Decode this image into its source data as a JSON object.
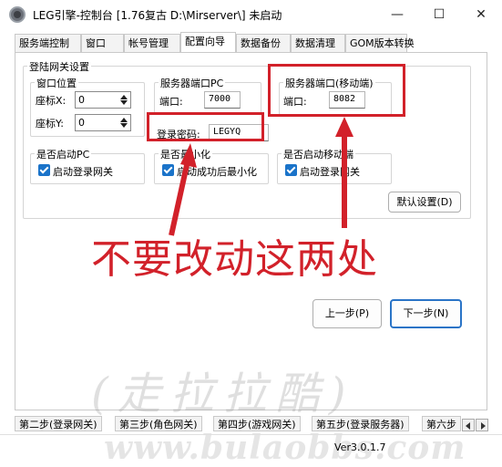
{
  "window": {
    "title": "LEG引擎-控制台 [1.76复古 D:\\Mirserver\\] 未启动",
    "minimize": "—",
    "maximize": "☐",
    "close": "✕"
  },
  "tabs": [
    "服务端控制",
    "窗口",
    "帐号管理",
    "配置向导",
    "数据备份",
    "数据清理",
    "GOM版本转换"
  ],
  "login_gateway": {
    "group_label": "登陆网关设置",
    "window_pos": {
      "label": "窗口位置",
      "x_label": "座标X:",
      "x_value": "0",
      "y_label": "座标Y:",
      "y_value": "0"
    },
    "server_pc": {
      "label": "服务器端口PC",
      "port_label": "端口:",
      "port_value": "7000"
    },
    "server_mobile": {
      "label": "服务器端口(移动端)",
      "port_label": "端口:",
      "port_value": "8082"
    },
    "password": {
      "label": "登录密码:",
      "value": "LEGYQ"
    },
    "start_pc": {
      "label": "是否启动PC",
      "checkbox_label": "启动登录网关"
    },
    "minimize": {
      "label": "是否最小化",
      "checkbox_label": "启动成功后最小化"
    },
    "start_mobile": {
      "label": "是否启动移动端",
      "checkbox_label": "启动登录网关"
    },
    "default_button": "默认设置(D)"
  },
  "annotation": "不要改动这两处",
  "nav": {
    "prev_button": "上一步(P)",
    "next_button": "下一步(N)"
  },
  "steps": [
    "第二步(登录网关)",
    "第三步(角色网关)",
    "第四步(游戏网关)",
    "第五步(登录服务器)",
    "第六步"
  ],
  "version": "Ver3.0.1.7",
  "watermark": "(走拉拉酷)",
  "watermark_url": "www.bulaobbs.com",
  "colors": {
    "annotation_red": "#d2212a",
    "checkbox_blue": "#1a73c9",
    "primary_border": "#2a74c7"
  }
}
